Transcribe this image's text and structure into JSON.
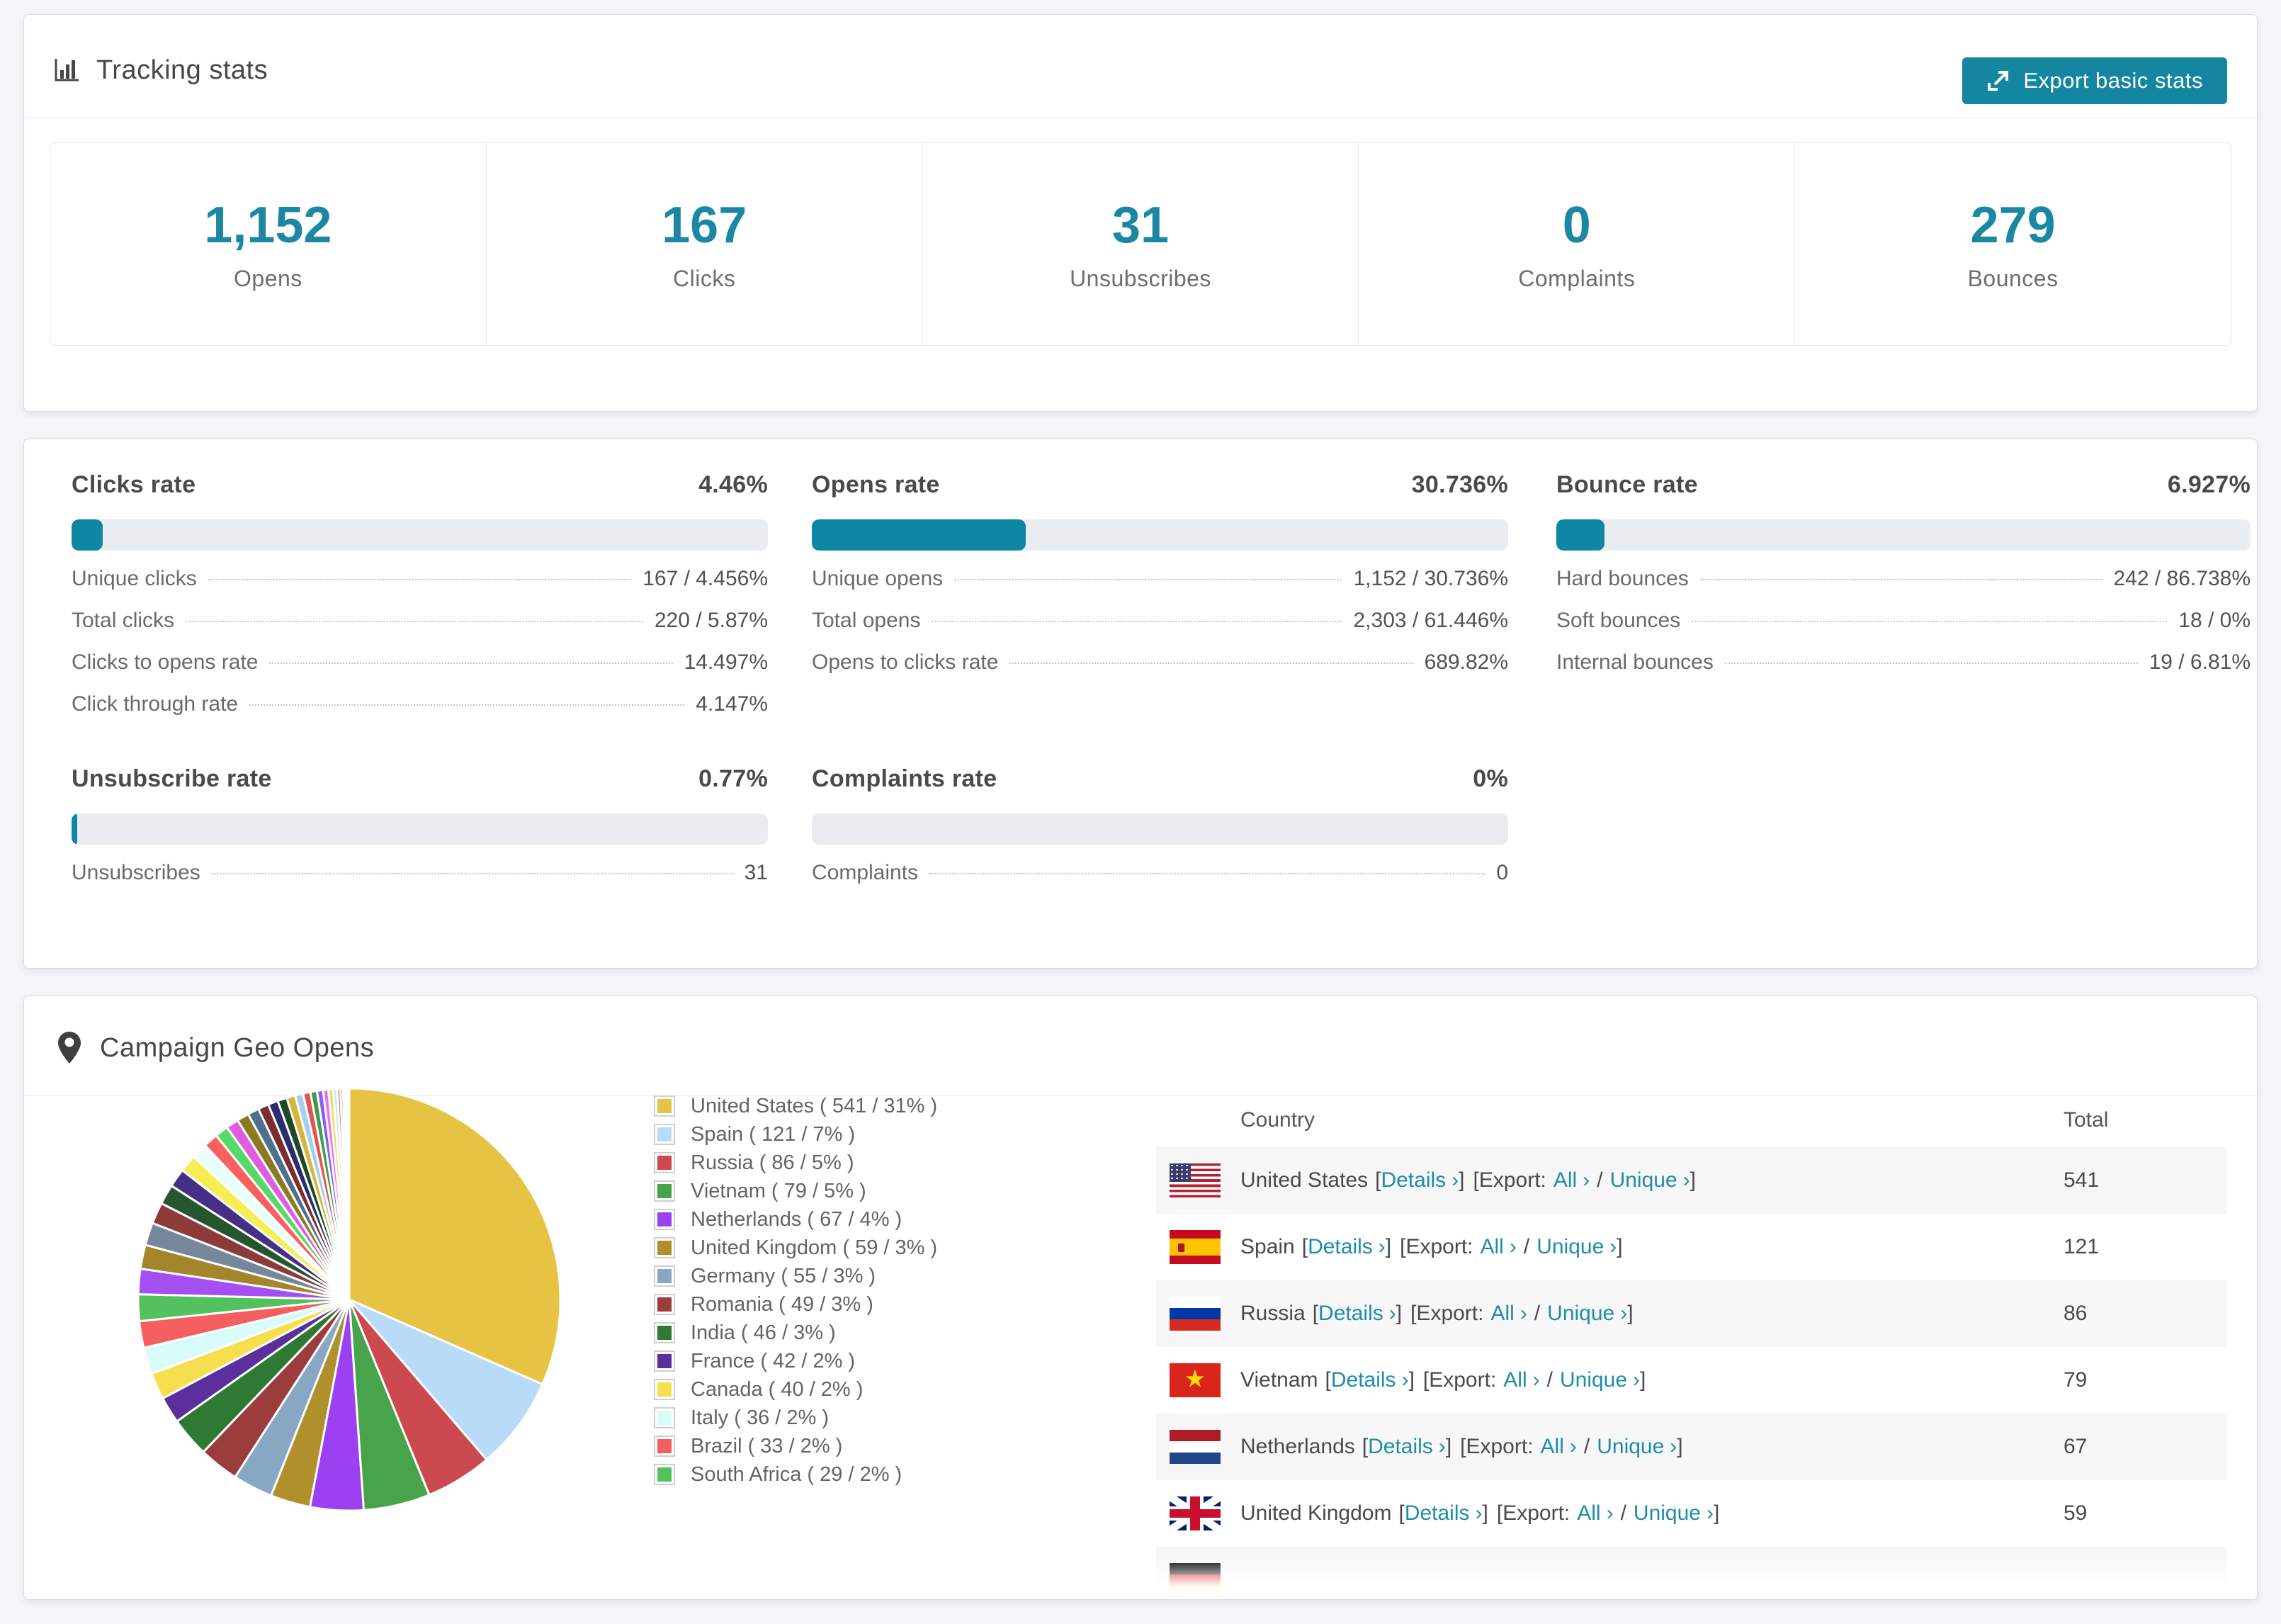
{
  "theme": {
    "accent": "#1486a2",
    "progress_track": "#e9edf2",
    "page_bg": "#f5f6f8",
    "row_stripe": "#f7f7f8"
  },
  "tracking": {
    "title": "Tracking stats",
    "export_button_label": "Export basic stats",
    "summary": [
      {
        "value": "1,152",
        "label": "Opens"
      },
      {
        "value": "167",
        "label": "Clicks"
      },
      {
        "value": "31",
        "label": "Unsubscribes"
      },
      {
        "value": "0",
        "label": "Complaints"
      },
      {
        "value": "279",
        "label": "Bounces"
      }
    ]
  },
  "rates": {
    "blocks": [
      {
        "title": "Clicks rate",
        "value": "4.46%",
        "percent": 4.46,
        "rows": [
          {
            "label": "Unique clicks",
            "value": "167 / 4.456%"
          },
          {
            "label": "Total clicks",
            "value": "220 / 5.87%"
          },
          {
            "label": "Clicks to opens rate",
            "value": "14.497%"
          },
          {
            "label": "Click through rate",
            "value": "4.147%"
          }
        ]
      },
      {
        "title": "Opens rate",
        "value": "30.736%",
        "percent": 30.736,
        "rows": [
          {
            "label": "Unique opens",
            "value": "1,152 / 30.736%"
          },
          {
            "label": "Total opens",
            "value": "2,303 / 61.446%"
          },
          {
            "label": "Opens to clicks rate",
            "value": "689.82%"
          }
        ]
      },
      {
        "title": "Bounce rate",
        "value": "6.927%",
        "percent": 6.927,
        "rows": [
          {
            "label": "Hard bounces",
            "value": "242 / 86.738%"
          },
          {
            "label": "Soft bounces",
            "value": "18 / 0%"
          },
          {
            "label": "Internal bounces",
            "value": "19 / 6.81%"
          }
        ]
      },
      {
        "title": "Unsubscribe rate",
        "value": "0.77%",
        "percent": 0.77,
        "rows": [
          {
            "label": "Unsubscribes",
            "value": "31"
          }
        ]
      },
      {
        "title": "Complaints rate",
        "value": "0%",
        "percent": 0,
        "rows": [
          {
            "label": "Complaints",
            "value": "0"
          }
        ]
      }
    ]
  },
  "geo": {
    "title": "Campaign Geo Opens",
    "legend": [
      {
        "label": "United States ( 541 / 31% )",
        "color": "#e7c344"
      },
      {
        "label": "Spain ( 121 / 7% )",
        "color": "#b8dcf7"
      },
      {
        "label": "Russia ( 86 / 5% )",
        "color": "#cc4a4f"
      },
      {
        "label": "Vietnam ( 79 / 5% )",
        "color": "#47a44b"
      },
      {
        "label": "Netherlands ( 67 / 4% )",
        "color": "#9c41f2"
      },
      {
        "label": "United Kingdom ( 59 / 3% )",
        "color": "#b08f2d"
      },
      {
        "label": "Germany ( 55 / 3% )",
        "color": "#87a7c2"
      },
      {
        "label": "Romania ( 49 / 3% )",
        "color": "#9c3d3d"
      },
      {
        "label": "India ( 46 / 3% )",
        "color": "#2e7a33"
      },
      {
        "label": "France ( 42 / 2% )",
        "color": "#5b2f9e"
      },
      {
        "label": "Canada ( 40 / 2% )",
        "color": "#f6df4e"
      },
      {
        "label": "Italy ( 36 / 2% )",
        "color": "#d7fcf9"
      },
      {
        "label": "Brazil ( 33 / 2% )",
        "color": "#f55f5f"
      },
      {
        "label": "South Africa ( 29 / 2% )",
        "color": "#54c15f"
      }
    ],
    "table": {
      "columns": [
        "Country",
        "Total"
      ],
      "link_labels": {
        "open_bracket": "[",
        "close_bracket": "]",
        "export_open": "[Export:",
        "details": "Details",
        "all": "All",
        "unique": "Unique",
        "slash": "/",
        "chevron": "›"
      },
      "rows": [
        {
          "country": "United States",
          "total": "541",
          "flag": "us"
        },
        {
          "country": "Spain",
          "total": "121",
          "flag": "es"
        },
        {
          "country": "Russia",
          "total": "86",
          "flag": "ru"
        },
        {
          "country": "Vietnam",
          "total": "79",
          "flag": "vn"
        },
        {
          "country": "Netherlands",
          "total": "67",
          "flag": "nl"
        },
        {
          "country": "United Kingdom",
          "total": "59",
          "flag": "gb"
        }
      ],
      "partial_row_flag": "de"
    },
    "chart_data": {
      "type": "pie",
      "title": "Campaign Geo Opens",
      "legend_position": "right",
      "start_angle_deg": 0,
      "direction": "clockwise",
      "slices": [
        {
          "name": "United States",
          "count": 541,
          "pct": 31,
          "color": "#e7c344"
        },
        {
          "name": "Spain",
          "count": 121,
          "pct": 7,
          "color": "#b8dcf7"
        },
        {
          "name": "Russia",
          "count": 86,
          "pct": 5,
          "color": "#cc4a4f"
        },
        {
          "name": "Vietnam",
          "count": 79,
          "pct": 5,
          "color": "#47a44b"
        },
        {
          "name": "Netherlands",
          "count": 67,
          "pct": 4,
          "color": "#9c41f2"
        },
        {
          "name": "United Kingdom",
          "count": 59,
          "pct": 3,
          "color": "#b08f2d"
        },
        {
          "name": "Germany",
          "count": 55,
          "pct": 3,
          "color": "#87a7c2"
        },
        {
          "name": "Romania",
          "count": 49,
          "pct": 3,
          "color": "#9c3d3d"
        },
        {
          "name": "India",
          "count": 46,
          "pct": 3,
          "color": "#2e7a33"
        },
        {
          "name": "France",
          "count": 42,
          "pct": 2,
          "color": "#5b2f9e"
        },
        {
          "name": "Canada",
          "count": 40,
          "pct": 2,
          "color": "#f6df4e"
        },
        {
          "name": "Italy",
          "count": 36,
          "pct": 2,
          "color": "#d7fcf9"
        },
        {
          "name": "Brazil",
          "count": 33,
          "pct": 2,
          "color": "#f55f5f"
        },
        {
          "name": "South Africa",
          "count": 29,
          "pct": 2,
          "color": "#54c15f"
        },
        {
          "name": "other",
          "pct": 1.9,
          "color": "#a54ff2"
        },
        {
          "name": "other",
          "pct": 1.8,
          "color": "#a3862c"
        },
        {
          "name": "other",
          "pct": 1.7,
          "color": "#75879a"
        },
        {
          "name": "other",
          "pct": 1.6,
          "color": "#8e3a3a"
        },
        {
          "name": "other",
          "pct": 1.5,
          "color": "#26562e"
        },
        {
          "name": "other",
          "pct": 1.4,
          "color": "#463086"
        },
        {
          "name": "other",
          "pct": 1.3,
          "color": "#f5ee55"
        },
        {
          "name": "other",
          "pct": 1.2,
          "color": "#e9fffc"
        },
        {
          "name": "other",
          "pct": 1.1,
          "color": "#fa6060"
        },
        {
          "name": "other",
          "pct": 1.0,
          "color": "#57d969"
        },
        {
          "name": "other",
          "pct": 0.95,
          "color": "#e05ce0"
        },
        {
          "name": "other",
          "pct": 0.9,
          "color": "#8a7a22"
        },
        {
          "name": "other",
          "pct": 0.85,
          "color": "#4f6f8f"
        },
        {
          "name": "other",
          "pct": 0.8,
          "color": "#7a2f2f"
        },
        {
          "name": "other",
          "pct": 0.75,
          "color": "#2b2b70"
        },
        {
          "name": "other",
          "pct": 0.7,
          "color": "#1d4a24"
        },
        {
          "name": "other",
          "pct": 0.65,
          "color": "#d4b73a"
        },
        {
          "name": "other",
          "pct": 0.6,
          "color": "#a9cdeb"
        },
        {
          "name": "other",
          "pct": 0.55,
          "color": "#e25454"
        },
        {
          "name": "other",
          "pct": 0.5,
          "color": "#3f9e4a"
        },
        {
          "name": "other",
          "pct": 0.45,
          "color": "#8b5cf6"
        },
        {
          "name": "other",
          "pct": 0.4,
          "color": "#ef6ef2"
        },
        {
          "name": "other",
          "pct": 0.35,
          "color": "#eede4d"
        },
        {
          "name": "other",
          "pct": 0.3,
          "color": "#bfe6f7"
        },
        {
          "name": "other",
          "pct": 0.25,
          "color": "#f08080"
        },
        {
          "name": "other",
          "pct": 0.2,
          "color": "#66d17a"
        },
        {
          "name": "other",
          "pct": 0.15,
          "color": "#c879f0"
        },
        {
          "name": "other",
          "pct": 0.12,
          "color": "#9a8a30"
        },
        {
          "name": "other",
          "pct": 0.1,
          "color": "#6b86a0"
        },
        {
          "name": "other",
          "pct": 0.08,
          "color": "#d04f4f"
        }
      ]
    }
  }
}
